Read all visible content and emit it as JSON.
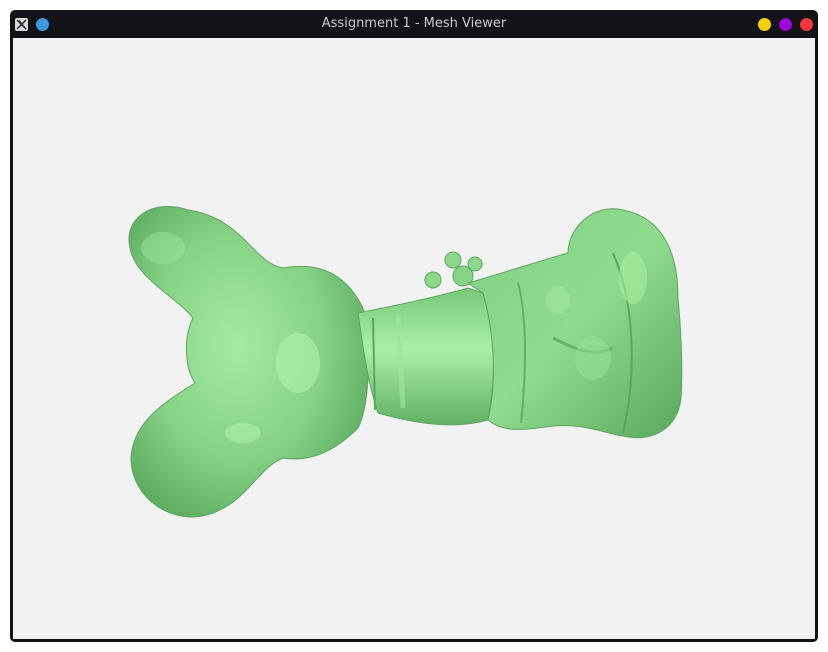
{
  "window": {
    "title": "Assignment 1 - Mesh Viewer",
    "app_icon": "x11-logo-icon",
    "left_buttons": [
      {
        "name": "sticky-button",
        "icon": "circle-icon",
        "color": "#3d9bdb"
      }
    ],
    "right_buttons": [
      {
        "name": "minimize-button",
        "icon": "circle-icon",
        "color": "#f5d000"
      },
      {
        "name": "maximize-button",
        "icon": "circle-icon",
        "color": "#a000e0"
      },
      {
        "name": "close-button",
        "icon": "circle-icon",
        "color": "#f0383c"
      }
    ]
  },
  "viewport": {
    "background": "#f2f2f2",
    "mesh_color": "#8ed88e",
    "mesh_shadow": "#5aa55a",
    "mesh_highlight": "#b6f5b4"
  }
}
